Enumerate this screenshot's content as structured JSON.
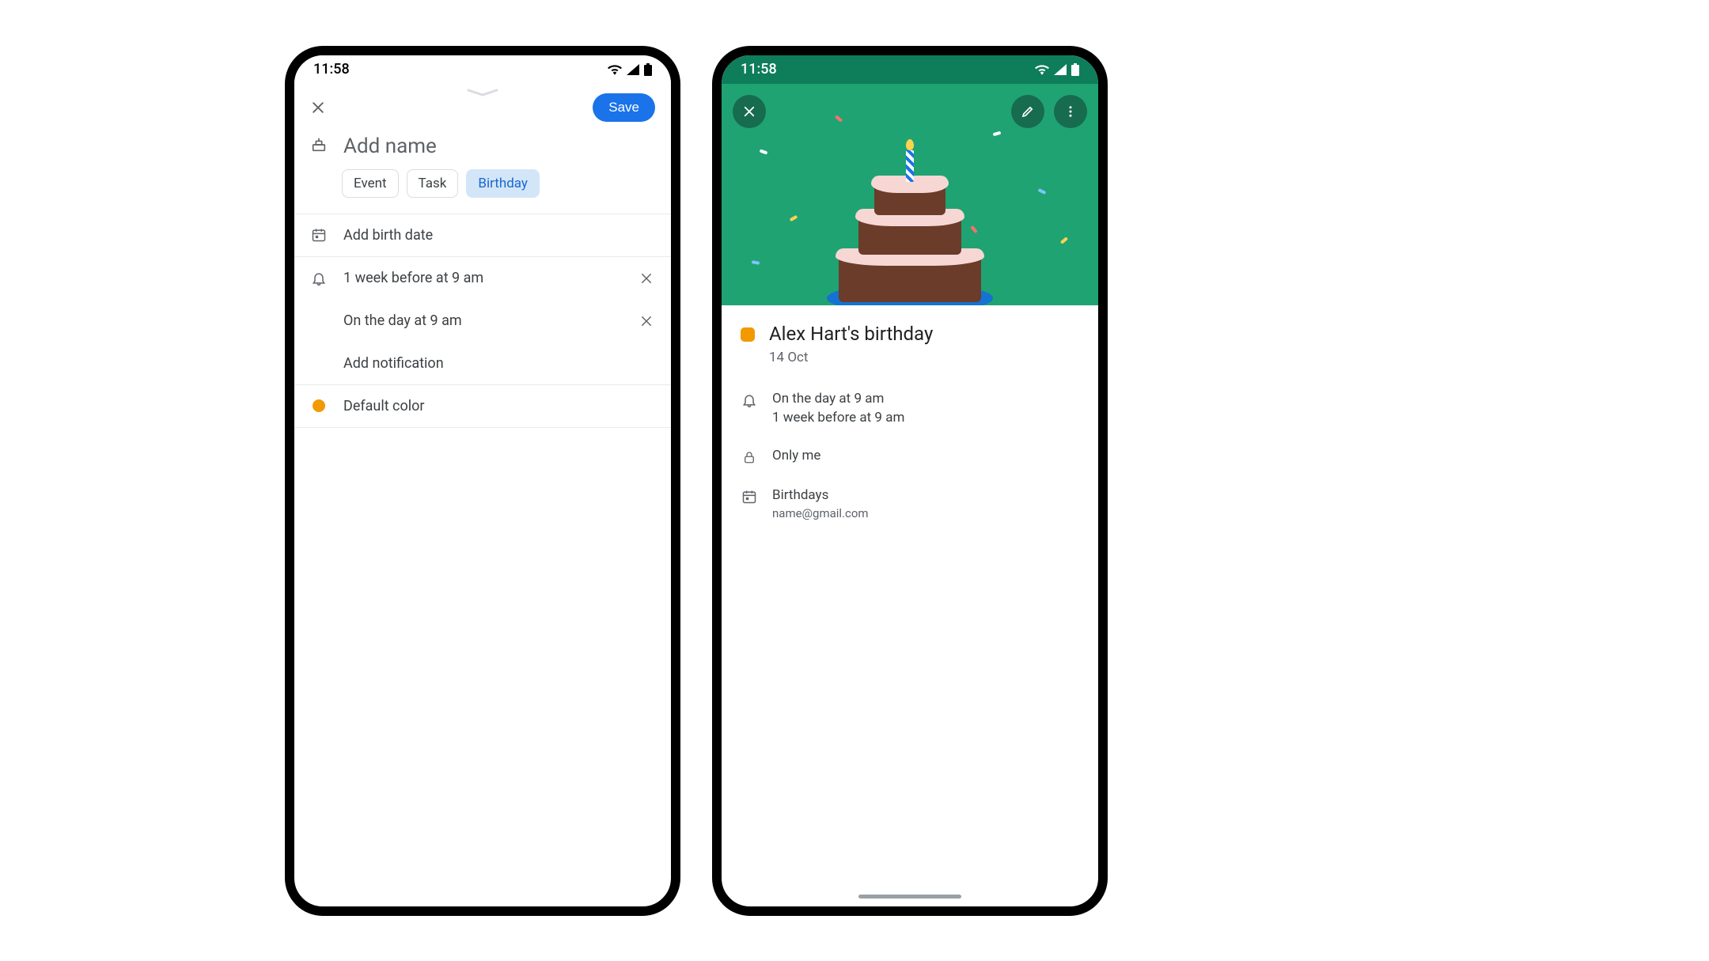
{
  "status": {
    "time": "11:58"
  },
  "editor": {
    "save_label": "Save",
    "title_placeholder": "Add name",
    "chips": {
      "event": "Event",
      "task": "Task",
      "birthday": "Birthday"
    },
    "birth_date_label": "Add birth date",
    "notifications": [
      "1 week before at 9 am",
      "On the day at 9 am"
    ],
    "add_notification_label": "Add notification",
    "color_label": "Default color",
    "color_hex": "#f29900"
  },
  "detail": {
    "title": "Alex Hart's birthday",
    "date": "14 Oct",
    "notifications": [
      "On the day at 9 am",
      "1 week before at 9 am"
    ],
    "visibility": "Only me",
    "calendar_name": "Birthdays",
    "account": "name@gmail.com",
    "color_hex": "#f29900"
  }
}
